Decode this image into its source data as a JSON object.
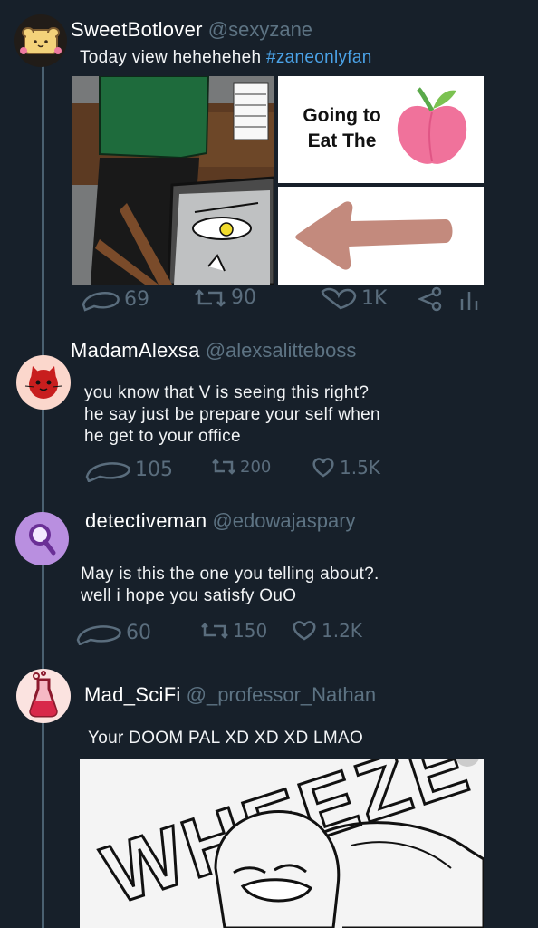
{
  "colors": {
    "background": "#17202a",
    "handle": "#5d7383",
    "hashtag": "#4ba3e8",
    "thread_line": "#4a6070"
  },
  "posts": [
    {
      "display_name": "SweetBotlover",
      "handle": "@sexyzane",
      "text": "Today view heheheheh",
      "hashtag": "#zaneonlyfan",
      "panel_text_line1": "Going to",
      "panel_text_line2": "Eat The",
      "replies": "69",
      "retweets": "90",
      "likes": "1K",
      "avatar_icon": "toast-bread-icon"
    },
    {
      "display_name": "MadamAlexsa",
      "handle": "@alexsalitteboss",
      "text_line1": "you know that V is seeing this right?",
      "text_line2": "he say just be prepare your self when",
      "text_line3": "he get to your office",
      "replies": "105",
      "retweets": "200",
      "likes": "1.5K",
      "avatar_icon": "red-cat-icon"
    },
    {
      "display_name": "detectiveman",
      "handle": "@edowajaspary",
      "text_line1": "May is this the one you telling about?.",
      "text_line2": "well i hope you satisfy OuO",
      "replies": "60",
      "retweets": "150",
      "likes": "1.2K",
      "avatar_icon": "magnifier-icon"
    },
    {
      "display_name": "Mad_SciFi",
      "handle": "@_professor_Nathan",
      "text": "Your DOOM PAL XD XD XD LMAO",
      "image_text": "WHEEZE",
      "avatar_icon": "flask-icon"
    }
  ]
}
